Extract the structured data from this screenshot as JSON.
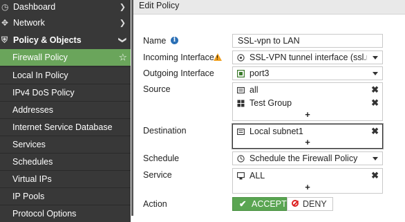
{
  "sidebar": {
    "items": [
      {
        "label": "Dashboard"
      },
      {
        "label": "Network"
      },
      {
        "label": "Policy & Objects"
      },
      {
        "label": "Firewall Policy"
      },
      {
        "label": "Local In Policy"
      },
      {
        "label": "IPv4 DoS Policy"
      },
      {
        "label": "Addresses"
      },
      {
        "label": "Internet Service Database"
      },
      {
        "label": "Services"
      },
      {
        "label": "Schedules"
      },
      {
        "label": "Virtual IPs"
      },
      {
        "label": "IP Pools"
      },
      {
        "label": "Protocol Options"
      }
    ],
    "icons": {
      "dashboard": "speedometer-icon",
      "network": "network-icon",
      "policy": "shield-icon"
    },
    "colors": {
      "background": "#383838",
      "active": "#6aa55b"
    }
  },
  "main": {
    "title": "Edit Policy",
    "form": {
      "name_label": "Name",
      "name_value": "SSL-vpn to LAN",
      "incoming_label": "Incoming Interface",
      "incoming_value": "SSL-VPN tunnel interface (ssl.roo",
      "outgoing_label": "Outgoing Interface",
      "outgoing_value": "port3",
      "source_label": "Source",
      "source_items": [
        "all",
        "Test Group"
      ],
      "destination_label": "Destination",
      "destination_items": [
        "Local subnet1"
      ],
      "schedule_label": "Schedule",
      "schedule_value": "Schedule the Firewall Policy",
      "service_label": "Service",
      "service_items": [
        "ALL"
      ],
      "action_label": "Action",
      "accept_label": "ACCEPT",
      "deny_label": "DENY",
      "add_symbol": "+",
      "remove_symbol": "✖"
    },
    "colors": {
      "accept": "#5aa552",
      "deny_icon": "#dd2222",
      "info": "#2a6fb5",
      "warning": "#f0a020"
    }
  }
}
